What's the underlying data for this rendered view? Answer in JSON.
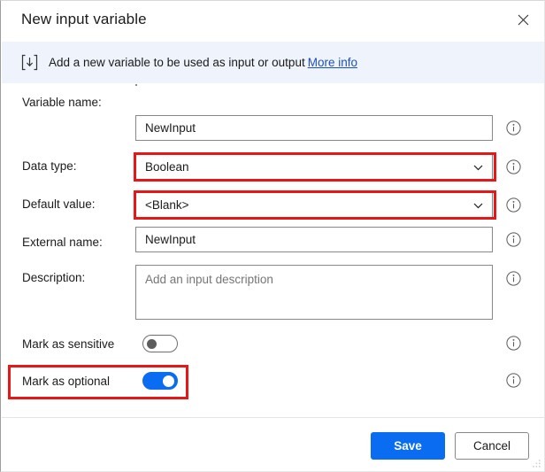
{
  "window": {
    "title": "New input variable",
    "close_icon": "close-icon",
    "resize_grip_icon": "resize-grip-icon"
  },
  "banner": {
    "icon": "input-variable-icon",
    "text": "Add a new variable to be used as input or output",
    "link_label": "More info",
    "background": "#eef3fc",
    "link_color": "#1f51b6"
  },
  "form": {
    "fields": [
      {
        "label": "Variable name:",
        "value": "NewInput",
        "type": "text",
        "is_placeholder": false,
        "highlighted": false,
        "info_icon": "info-icon"
      },
      {
        "label": "Data type:",
        "value": "Boolean",
        "type": "dropdown",
        "is_placeholder": false,
        "highlighted": true,
        "chevron_icon": "chevron-down-icon",
        "info_icon": "info-icon"
      },
      {
        "label": "Default value:",
        "value": "<Blank>",
        "type": "dropdown",
        "is_placeholder": false,
        "highlighted": true,
        "chevron_icon": "chevron-down-icon",
        "info_icon": "info-icon"
      },
      {
        "label": "External name:",
        "value": "NewInput",
        "type": "text",
        "is_placeholder": false,
        "highlighted": false,
        "info_icon": "info-icon"
      },
      {
        "label": "Description:",
        "value": "Add an input description",
        "type": "textarea",
        "is_placeholder": true,
        "highlighted": false,
        "info_icon": "info-icon"
      }
    ],
    "toggles": [
      {
        "label": "Mark as sensitive",
        "state": "off",
        "highlighted": false,
        "info_icon": "info-icon"
      },
      {
        "label": "Mark as optional",
        "state": "on",
        "highlighted": true,
        "info_icon": "info-icon"
      }
    ]
  },
  "footer": {
    "save_label": "Save",
    "cancel_label": "Cancel"
  },
  "colors": {
    "accent": "#0a6cf0",
    "highlight": "#e81717",
    "banner_bg": "#eef3fc"
  }
}
